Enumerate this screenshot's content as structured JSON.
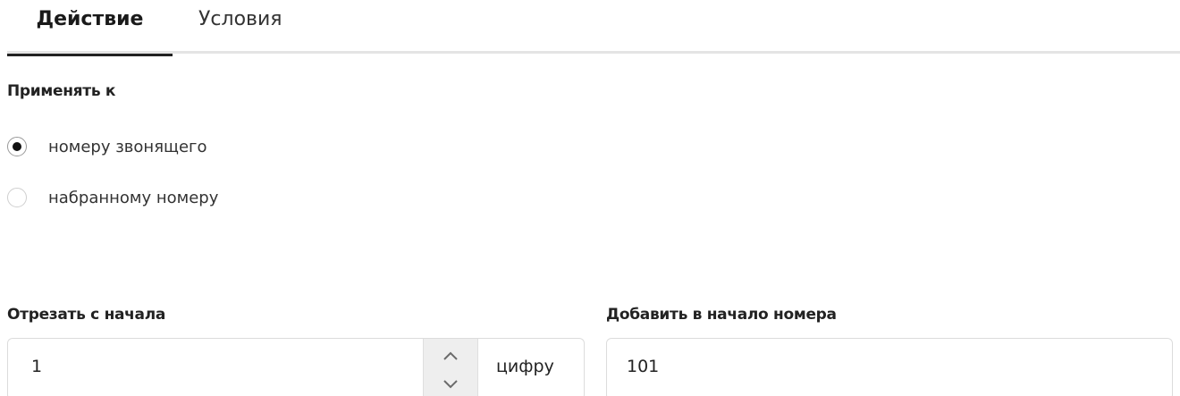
{
  "tabs": [
    {
      "label": "Действие",
      "active": true
    },
    {
      "label": "Условия",
      "active": false
    }
  ],
  "apply_to": {
    "title": "Применять к",
    "options": [
      {
        "label": "номеру звонящего",
        "checked": true
      },
      {
        "label": "набранному номеру",
        "checked": false
      }
    ]
  },
  "trim": {
    "label": "Отрезать с начала",
    "value": "1",
    "suffix": "цифру",
    "up_icon": "chevron-up-icon",
    "down_icon": "chevron-down-icon"
  },
  "prefix": {
    "label": "Добавить в начало номера",
    "value": "101"
  }
}
